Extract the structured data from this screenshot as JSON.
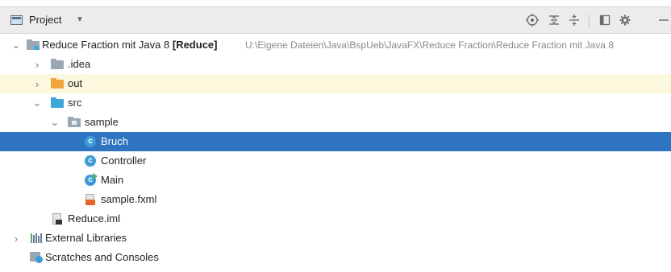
{
  "panel": {
    "title": "Project",
    "dropdown_icon": "dropdown-triangle",
    "toolbar": [
      {
        "name": "locate-icon",
        "glyph": "target"
      },
      {
        "name": "expand-all-icon",
        "glyph": "expand"
      },
      {
        "name": "collapse-all-icon",
        "glyph": "collapse"
      },
      {
        "name": "show-options-icon",
        "glyph": "window"
      },
      {
        "name": "settings-gear-icon",
        "glyph": "gear"
      },
      {
        "name": "hide-icon",
        "glyph": "minus"
      }
    ]
  },
  "tree": {
    "root": {
      "name": "Reduce Fraction mit Java 8",
      "module": "[Reduce]",
      "path": "U:\\Eigene Dateien\\Java\\BspUeb\\JavaFX\\Reduce Fraction\\Reduce Fraction mit Java 8"
    },
    "idea": ".idea",
    "out": "out",
    "src": "src",
    "sample": "sample",
    "bruch": "Bruch",
    "controller": "Controller",
    "main": "Main",
    "fxml": "sample.fxml",
    "iml": "Reduce.iml",
    "ext_libs": "External Libraries",
    "scratches": "Scratches and Consoles",
    "class_letter": "c"
  },
  "colors": {
    "selection": "#2f74c0",
    "highlight_row": "#fcf8de",
    "header_bg": "#ececec",
    "src_folder": "#40a7d9",
    "out_folder": "#f0a43a",
    "class_icon": "#3d9bd8"
  }
}
